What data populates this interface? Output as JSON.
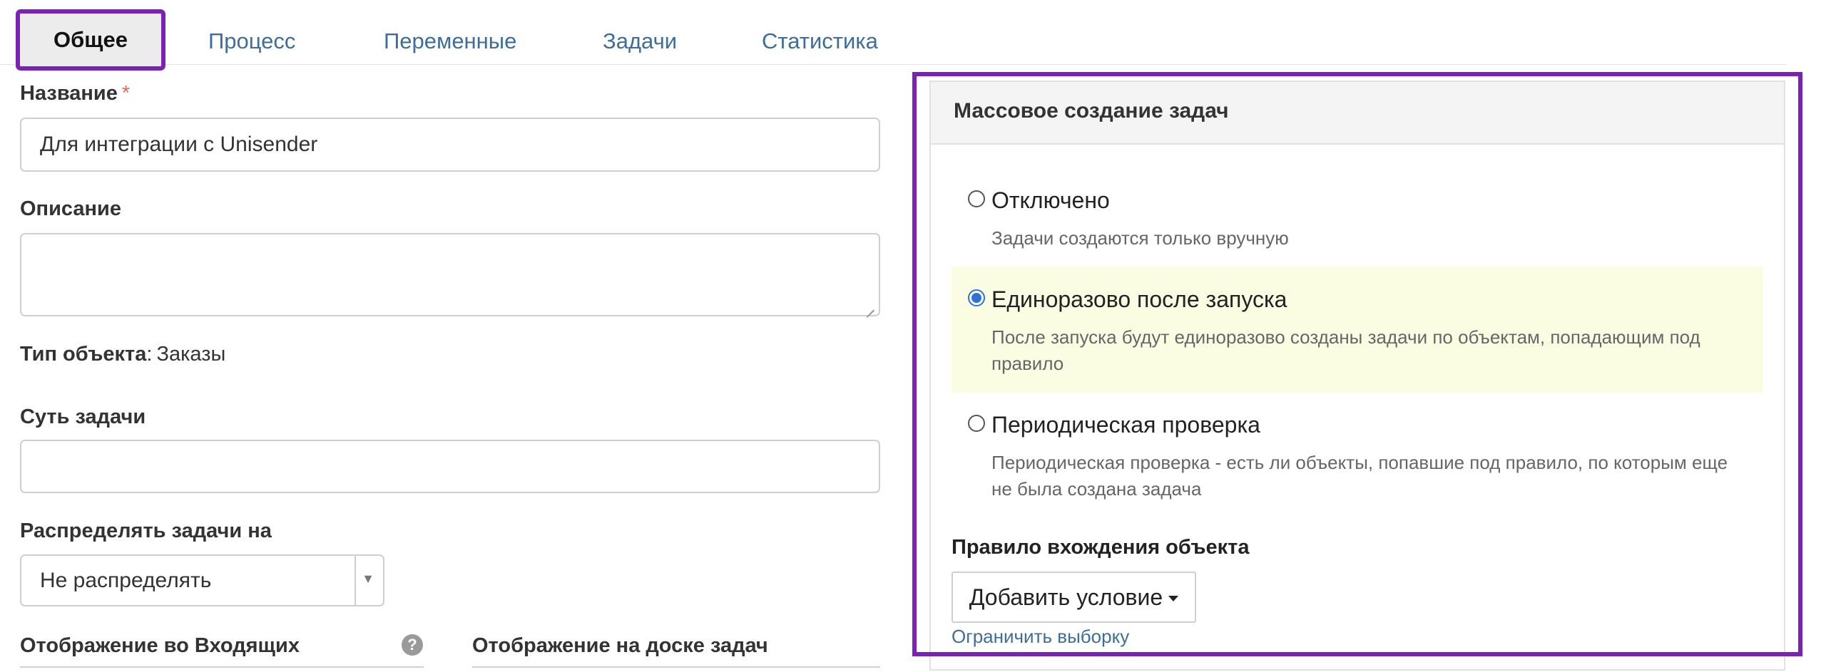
{
  "tabs": [
    {
      "label": "Общее",
      "active": true
    },
    {
      "label": "Процесс",
      "active": false
    },
    {
      "label": "Переменные",
      "active": false
    },
    {
      "label": "Задачи",
      "active": false
    },
    {
      "label": "Статистика",
      "active": false
    }
  ],
  "form": {
    "name_label": "Название",
    "name_required_mark": "*",
    "name_value": "Для интеграции с Unisender",
    "description_label": "Описание",
    "description_value": "",
    "object_type_label": "Тип объекта",
    "object_type_separator": ":",
    "object_type_value": "Заказы",
    "task_essence_label": "Суть задачи",
    "task_essence_value": "",
    "distribute_label": "Распределять задачи на",
    "distribute_value": "Не распределять",
    "inbox_display_label": "Отображение во Входящих",
    "board_display_label": "Отображение на доске задач"
  },
  "mass_creation": {
    "title": "Массовое создание задач",
    "options": [
      {
        "label": "Отключено",
        "description": "Задачи создаются только вручную",
        "checked": false
      },
      {
        "label": "Единоразово после запуска",
        "description": "После запуска будут единоразово созданы задачи по объектам, попадающим под правило",
        "checked": true
      },
      {
        "label": "Периодическая проверка",
        "description": "Периодическая проверка - есть ли объекты, попавшие под правило, по которым еще не была создана задача",
        "checked": false
      }
    ],
    "rule_label": "Правило вхождения объекта",
    "add_condition_button": "Добавить условие",
    "limit_link": "Ограничить выборку"
  },
  "colors": {
    "accent": "#7a22b8",
    "link": "#3d6e9b",
    "highlight": "#fbfde3",
    "radio": "#2f73d8"
  }
}
